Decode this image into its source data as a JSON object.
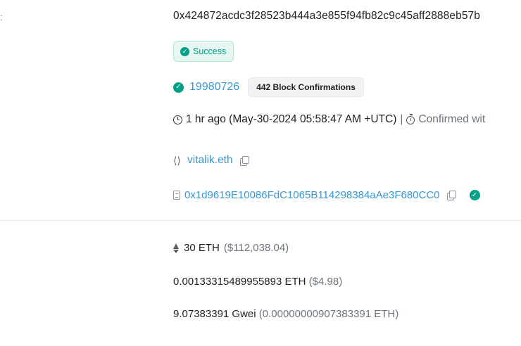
{
  "tx": {
    "hash": "0x424872acdc3f28523b444a3e855f94fb82c9c45aff2888eb57b",
    "status": "Success",
    "block": "19980726",
    "confirmations": "442 Block Confirmations",
    "timestamp": "1 hr ago (May-30-2024 05:58:47 AM +UTC)",
    "separator": "|",
    "confirmed_text": "Confirmed wit",
    "from_ens": "vitalik.eth",
    "to_contract": "0x1d9619E10086FdC1065B114298384aAe3F680CC0",
    "value_eth": "30 ETH",
    "value_usd": "($112,038.04)",
    "fee_eth": "0.00133315489955893 ETH",
    "fee_usd": "($4.98)",
    "gas_price_gwei": "9.07383391 Gwei",
    "gas_price_eth": "(0.00000000907383391 ETH)"
  },
  "icons": {
    "status": "check-circle-icon",
    "block": "check-circle-icon",
    "time": "clock-icon",
    "confirmed": "stopwatch-icon",
    "ens": "ens-icon",
    "copy": "copy-icon",
    "contract": "document-icon",
    "value": "ethereum-icon"
  },
  "colors": {
    "success": "#00a186",
    "link": "#3498db",
    "muted": "#6c757d"
  }
}
